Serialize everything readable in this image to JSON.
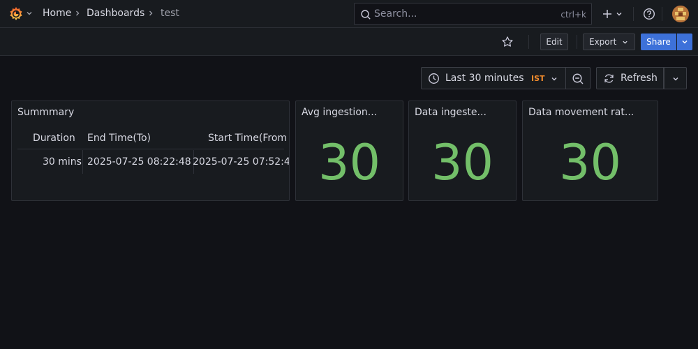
{
  "nav": {
    "breadcrumbs": [
      "Home",
      "Dashboards",
      "test"
    ],
    "search_placeholder": "Search...",
    "search_shortcut": "ctrl+k"
  },
  "toolbar": {
    "edit_label": "Edit",
    "export_label": "Export",
    "share_label": "Share"
  },
  "time": {
    "range_label": "Last 30 minutes",
    "timezone": "IST",
    "refresh_label": "Refresh"
  },
  "colors": {
    "accent": "#3d71d9",
    "stat_green": "#73bf69",
    "timezone_orange": "#f28b2c"
  },
  "panels": {
    "summary": {
      "title": "Summmary",
      "columns": [
        "Duration",
        "End Time(To)",
        "Start Time(From"
      ],
      "rows": [
        [
          "30 mins",
          "2025-07-25 08:22:48",
          "2025-07-25 07:52:4"
        ]
      ]
    },
    "stats": [
      {
        "title": "Avg ingestion...",
        "value": "30"
      },
      {
        "title": "Data ingeste...",
        "value": "30"
      },
      {
        "title": "Data movement rat...",
        "value": "30"
      }
    ]
  }
}
